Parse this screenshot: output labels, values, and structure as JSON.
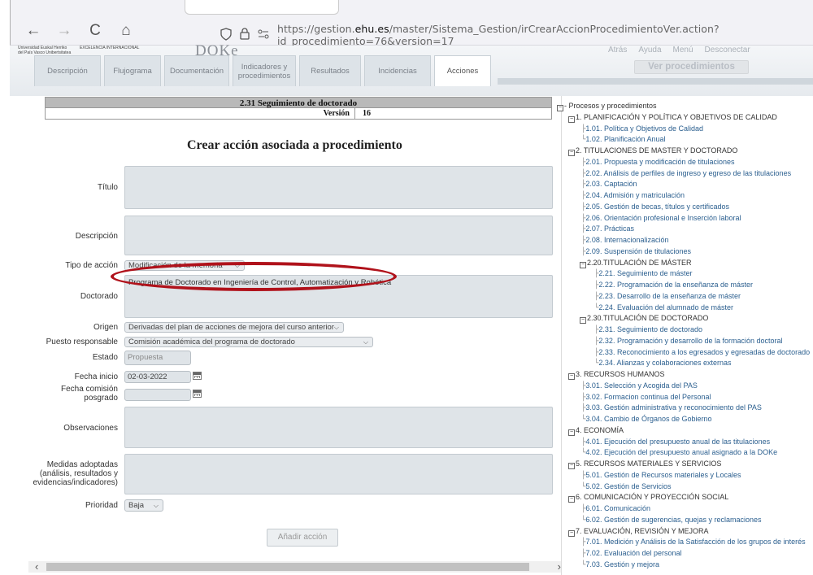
{
  "browser": {
    "nav_back": "←",
    "nav_forward": "→",
    "nav_reload": "C",
    "nav_home": "⌂",
    "url_prefix": "https://gestion.",
    "url_host": "ehu.es",
    "url_path": "/master/Sistema_Gestion/irCrearAccionProcedimientoVer.action?id_procedimiento=76&version=17"
  },
  "header": {
    "university_line1": "Universidad   Euskal Herriko",
    "university_line2": "del País Vasco   Unibertsitatea",
    "excellence": "EXCELENCIA INTERNACIONAL",
    "app_name": "DOKe",
    "top_links": [
      "Atrás",
      "Ayuda",
      "Menú",
      "Desconectar"
    ],
    "ver_procedimientos": "Ver procedimientos",
    "tabs": [
      "Descripción",
      "Flujograma",
      "Documentación",
      "Indicadores y procedimientos",
      "Resultados",
      "Incidencias",
      "Acciones"
    ]
  },
  "form": {
    "procedure_title": "2.31 Seguimiento de doctorado",
    "version_label": "Versión",
    "version_value": "16",
    "heading": "Crear acción asociada a procedimiento",
    "labels": {
      "titulo": "Título",
      "descripcion": "Descripción",
      "tipo_accion": "Tipo de acción",
      "doctorado": "Doctorado",
      "origen": "Origen",
      "puesto": "Puesto responsable",
      "estado": "Estado",
      "fecha_inicio": "Fecha inicio",
      "fecha_comision": "Fecha comisión posgrado",
      "observaciones": "Observaciones",
      "medidas": "Medidas adoptadas (análisis, resultados y evidencias/indicadores)",
      "prioridad": "Prioridad"
    },
    "values": {
      "tipo_accion": "Modificación de la memoria",
      "doctorado": "Programa de Doctorado en Ingeniería de Control, Automatización y Robótica",
      "origen": "Derivadas del plan de acciones de mejora del curso anterior",
      "puesto": "Comisión académica del programa de doctorado",
      "estado": "Propuesta",
      "fecha_inicio": "02-03-2022",
      "fecha_comision": "",
      "prioridad": "Baja"
    },
    "submit": "Añadir acción"
  },
  "tree": {
    "root": "Procesos y procedimientos",
    "sections": [
      {
        "title": "1. PLANIFICACIÓN Y POLÍTICA Y OBJETIVOS DE CALIDAD",
        "items": [
          {
            "label": "1.01. Política y Objetivos de Calidad"
          },
          {
            "label": "1.02. Planificación Anual"
          }
        ]
      },
      {
        "title": "2. TITULACIONES DE MASTER Y DOCTORADO",
        "items": [
          {
            "label": "2.01. Propuesta y modificación de titulaciones"
          },
          {
            "label": "2.02. Análisis de perfiles de ingreso y egreso de las titulaciones"
          },
          {
            "label": "2.03. Captación"
          },
          {
            "label": "2.04. Admisión y matriculación"
          },
          {
            "label": "2.05. Gestión de becas, títulos y certificados"
          },
          {
            "label": "2.06. Orientación profesional e Inserción laboral"
          },
          {
            "label": "2.07. Prácticas"
          },
          {
            "label": "2.08. Internacionalización"
          },
          {
            "label": "2.09. Suspensión de titulaciones"
          },
          {
            "label": "2.20.TITULACIÓN DE MÁSTER",
            "group": true,
            "items": [
              "2.21. Seguimiento de máster",
              "2.22. Programación de la enseñanza de máster",
              "2.23. Desarrollo de la enseñanza de máster",
              "2.24. Evaluación del alumnado de máster"
            ]
          },
          {
            "label": "2.30.TITULACIÓN DE DOCTORADO",
            "group": true,
            "items": [
              "2.31. Seguimiento de doctorado",
              "2.32. Programación y desarrollo de la formación doctoral",
              "2.33. Reconocimiento a los egresados y egresadas de doctorado",
              "2.34. Alianzas y colaboraciones externas"
            ]
          }
        ]
      },
      {
        "title": "3. RECURSOS HUMANOS",
        "items": [
          {
            "label": "3.01. Selección y Acogida del PAS"
          },
          {
            "label": "3.02. Formacion continua del Personal"
          },
          {
            "label": "3.03. Gestión administrativa y reconocimiento del PAS"
          },
          {
            "label": "3.04. Cambio de Órganos de Gobierno"
          }
        ]
      },
      {
        "title": "4. ECONOMÍA",
        "items": [
          {
            "label": "4.01. Ejecución del presupuesto anual de las titulaciones"
          },
          {
            "label": "4.02. Ejecución del presupuesto anual asignado a la DOKe"
          }
        ]
      },
      {
        "title": "5. RECURSOS MATERIALES Y SERVICIOS",
        "items": [
          {
            "label": "5.01. Gestión de Recursos materiales y Locales"
          },
          {
            "label": "5.02. Gestión de Servicios"
          }
        ]
      },
      {
        "title": "6. COMUNICACIÓN Y PROYECCIÓN SOCIAL",
        "items": [
          {
            "label": "6.01. Comunicación"
          },
          {
            "label": "6.02. Gestión de sugerencias, quejas y reclamaciones"
          }
        ]
      },
      {
        "title": "7. EVALUACIÓN, REVISIÓN Y MEJORA",
        "items": [
          {
            "label": "7.01. Medición y Análisis de la Satisfacción de los grupos de interés"
          },
          {
            "label": "7.02. Evaluación del personal"
          },
          {
            "label": "7.03. Gestión y mejora"
          }
        ]
      }
    ]
  },
  "colors": {
    "highlight_ellipse": "#b0121b",
    "tree_link": "#2b5f8f",
    "title_bar": "#b9b9b9"
  }
}
